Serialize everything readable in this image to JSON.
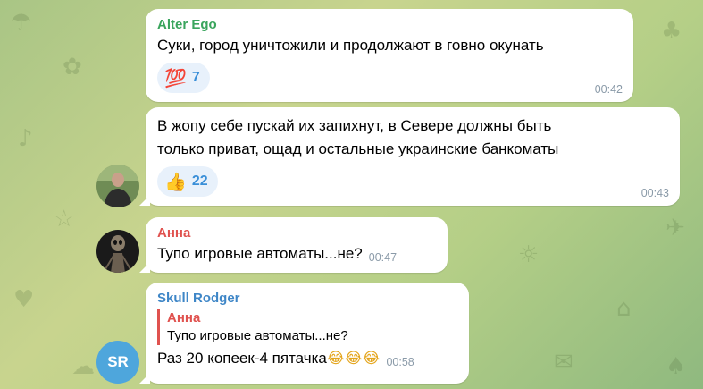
{
  "colors": {
    "alter_ego_name": "#3aa55d",
    "anna_name": "#e0524f",
    "skull_rodger_name": "#3e86c7",
    "reaction_count": "#3a8fd8",
    "time": "#8a9aa8"
  },
  "messages": [
    {
      "sender": "Alter Ego",
      "text": "Суки, город уничтожили и продолжают в говно окунать",
      "reaction": {
        "emoji": "💯",
        "icon": "hundred-points-icon",
        "count": "7"
      },
      "time": "00:42"
    },
    {
      "sender": "",
      "text_line1": "В жопу себе пускай их запихнут, в Севере должны быть",
      "text_line2": "только приват, ощад и остальные украинские банкоматы",
      "reaction": {
        "emoji": "👍",
        "icon": "thumbs-up-icon",
        "count": "22"
      },
      "time": "00:43",
      "avatar": "photo"
    },
    {
      "sender": "Анна",
      "text": "Тупо игровые автоматы...не?",
      "time": "00:47",
      "avatar": "alien-figure"
    },
    {
      "sender": "Skull Rodger",
      "reply": {
        "name": "Анна",
        "text": "Тупо игровые автоматы...не?"
      },
      "text": "Раз 20 копеек-4 пятачка",
      "emojis": "😂😂😂",
      "time": "00:58",
      "avatar_initials": "SR"
    }
  ]
}
